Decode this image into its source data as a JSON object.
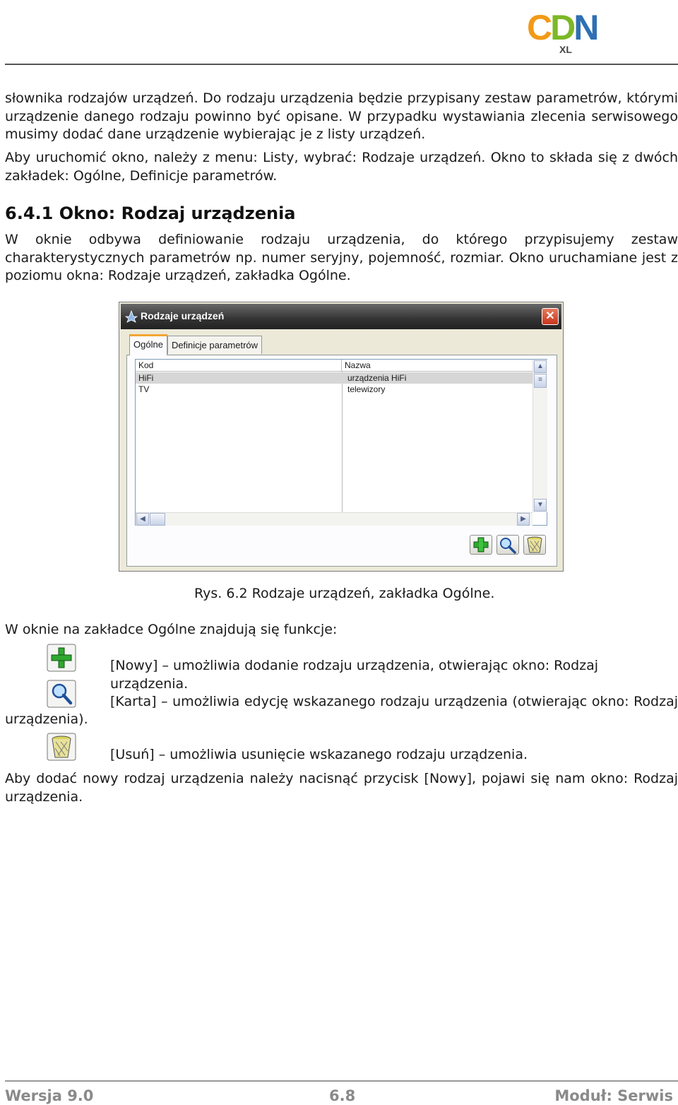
{
  "logo": {
    "part1": "C",
    "part2": "D",
    "part3": "N",
    "sub": "XL"
  },
  "paragraphs": {
    "p1": "słownika rodzajów urządzeń. Do rodzaju urządzenia będzie przypisany zestaw parametrów, którymi urządzenie danego rodzaju powinno być opisane. W przypadku wystawiania zlecenia serwisowego musimy dodać dane urządzenie wybierając je z listy urządzeń.",
    "p2": "Aby uruchomić okno, należy z menu: Listy, wybrać: Rodzaje urządzeń. Okno to składa się z dwóch zakładek: Ogólne, Definicje parametrów.",
    "heading": "6.4.1 Okno: Rodzaj urządzenia",
    "p3": "W oknie odbywa definiowanie rodzaju urządzenia, do którego przypisujemy zestaw charakterystycznych parametrów np. numer seryjny, pojemność, rozmiar. Okno uruchamiane jest z poziomu okna: Rodzaje urządzeń, zakładka Ogólne."
  },
  "dialog": {
    "title": "Rodzaje urządzeń",
    "close": "✕",
    "tabs": [
      "Ogólne",
      "Definicje parametrów"
    ],
    "grid": {
      "headers": [
        "Kod",
        "Nazwa"
      ],
      "rows": [
        {
          "kod": "HiFi",
          "nazwa": "urządzenia HiFi"
        },
        {
          "kod": "TV",
          "nazwa": "telewizory"
        }
      ]
    }
  },
  "caption": "Rys. 6.2 Rodzaje urządzeń, zakładka Ogólne.",
  "functions": {
    "intro": "W oknie na zakładce Ogólne znajdują się funkcje:",
    "nowy": "[Nowy] – umożliwia dodanie rodzaju urządzenia, otwierając okno: Rodzaj urządzenia.",
    "karta": "[Karta] – umożliwia edycję wskazanego rodzaju urządzenia (otwierając okno: Rodzaj",
    "karta_cont": "urządzenia).",
    "usun": "[Usuń] – umożliwia usunięcie wskazanego rodzaju urządzenia."
  },
  "p4": "Aby dodać nowy rodzaj urządzenia należy nacisnąć przycisk [Nowy], pojawi się nam okno: Rodzaj urządzenia.",
  "footer": {
    "left": "Wersja 9.0",
    "mid": "6.8",
    "right": "Moduł: Serwis"
  },
  "colors": {
    "logo_c": "#f29a17",
    "logo_d": "#7cb826",
    "logo_n": "#2f6fb3"
  },
  "icons": {
    "nowy": "plus-icon",
    "karta": "magnifier-icon",
    "usun": "trash-icon"
  }
}
